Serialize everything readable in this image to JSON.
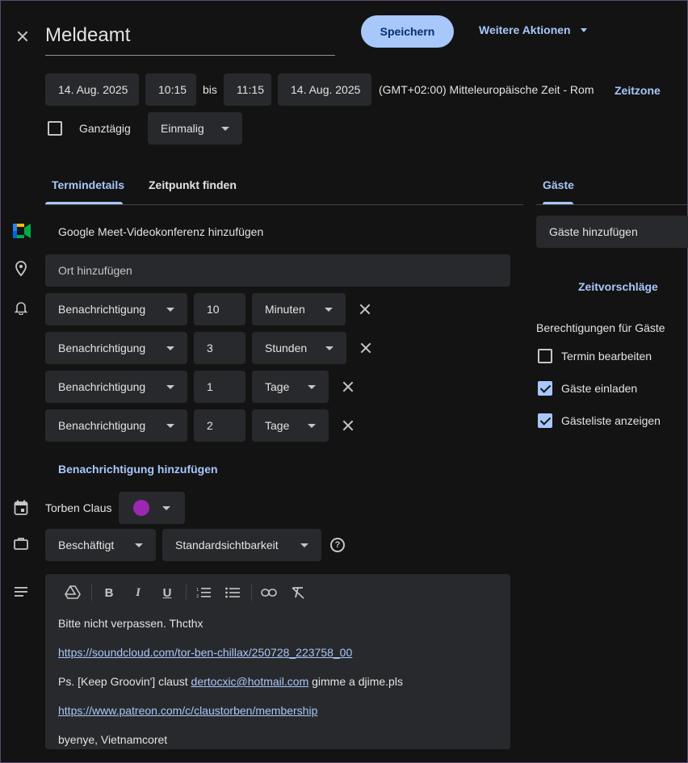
{
  "header": {
    "title": "Meldeamt",
    "save_label": "Speichern",
    "more_actions_label": "Weitere Aktionen"
  },
  "datetime": {
    "start_date": "14. Aug. 2025",
    "start_time": "10:15",
    "separator": "bis",
    "end_time": "11:15",
    "end_date": "14. Aug. 2025",
    "timezone": "(GMT+02:00) Mitteleuropäische Zeit - Rom",
    "timezone_button": "Zeitzone",
    "all_day_label": "Ganztägig",
    "recurrence": "Einmalig"
  },
  "tabs": {
    "details": "Termindetails",
    "find_time": "Zeitpunkt finden",
    "guests": "Gäste"
  },
  "details": {
    "meet_label": "Google Meet-Videokonferenz hinzufügen",
    "location_placeholder": "Ort hinzufügen",
    "notifications": [
      {
        "type": "Benachrichtigung",
        "value": "10",
        "unit": "Minuten"
      },
      {
        "type": "Benachrichtigung",
        "value": "3",
        "unit": "Stunden"
      },
      {
        "type": "Benachrichtigung",
        "value": "1",
        "unit": "Tage"
      },
      {
        "type": "Benachrichtigung",
        "value": "2",
        "unit": "Tage"
      }
    ],
    "add_notification": "Benachrichtigung hinzufügen",
    "calendar_owner": "Torben Claus",
    "calendar_color": "#9c27b0",
    "availability": "Beschäftigt",
    "visibility": "Standardsichtbarkeit",
    "description": {
      "line1": "Bitte nicht verpassen. Thcthx",
      "link1": "https://soundcloud.com/tor-ben-chillax/250728_223758_00",
      "line3_prefix": "Ps. [Keep Groovin'] claust ",
      "line3_email": "dertocxic@hotmail.com",
      "line3_suffix": " gimme a djime.pls",
      "link2": "https://www.patreon.com/c/claustorben/membership",
      "line5": "byenye, Vietnamcoret"
    }
  },
  "guests": {
    "add_placeholder": "Gäste hinzufügen",
    "suggestions": "Zeitvorschläge",
    "permissions_title": "Berechtigungen für Gäste",
    "permissions": [
      {
        "label": "Termin bearbeiten",
        "checked": false
      },
      {
        "label": "Gäste einladen",
        "checked": true
      },
      {
        "label": "Gästeliste anzeigen",
        "checked": true
      }
    ]
  }
}
